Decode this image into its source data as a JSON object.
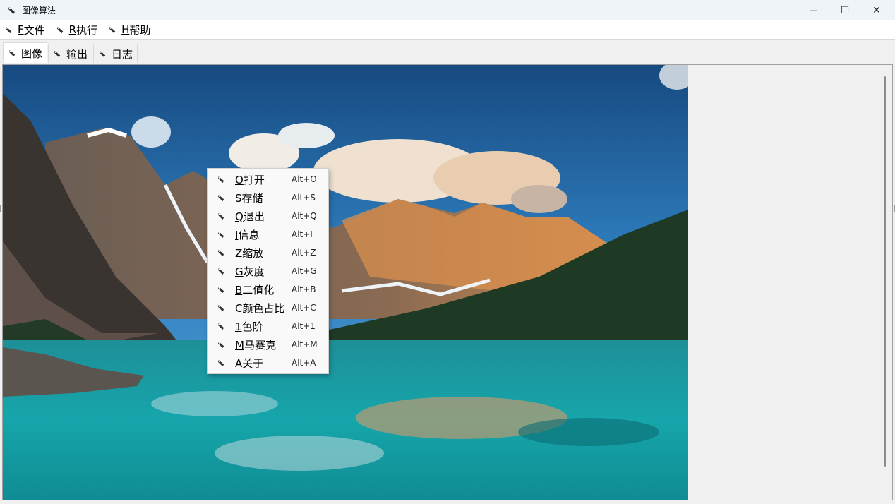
{
  "window": {
    "title": "图像算法",
    "controls": {
      "minimize": "—",
      "maximize": "☐",
      "close": "✕"
    }
  },
  "menubar": {
    "items": [
      {
        "key": "F",
        "label": "文件"
      },
      {
        "key": "R",
        "label": "执行"
      },
      {
        "key": "H",
        "label": "帮助"
      }
    ]
  },
  "tabs": [
    {
      "label": "图像",
      "active": true
    },
    {
      "label": "输出",
      "active": false
    },
    {
      "label": "日志",
      "active": false
    }
  ],
  "context_menu": {
    "items": [
      {
        "key": "O",
        "label": "打开",
        "shortcut": "Alt+O"
      },
      {
        "key": "S",
        "label": "存储",
        "shortcut": "Alt+S"
      },
      {
        "key": "Q",
        "label": "退出",
        "shortcut": "Alt+Q"
      },
      {
        "key": "I",
        "label": "信息",
        "shortcut": "Alt+I"
      },
      {
        "key": "Z",
        "label": "缩放",
        "shortcut": "Alt+Z"
      },
      {
        "key": "G",
        "label": "灰度",
        "shortcut": "Alt+G"
      },
      {
        "key": "B",
        "label": "二值化",
        "shortcut": "Alt+B"
      },
      {
        "key": "C",
        "label": "颜色占比",
        "shortcut": "Alt+C"
      },
      {
        "key": "1",
        "label": "色阶",
        "shortcut": "Alt+1"
      },
      {
        "key": "M",
        "label": "马赛克",
        "shortcut": "Alt+M"
      },
      {
        "key": "A",
        "label": "关于",
        "shortcut": "Alt+A"
      }
    ]
  },
  "image": {
    "subject": "mountain-lake-landscape"
  },
  "colors": {
    "sky_top": "#1b4f86",
    "sky_low": "#3f8fcc",
    "lake": "#1aa3a6",
    "forest": "#1f3a24"
  }
}
